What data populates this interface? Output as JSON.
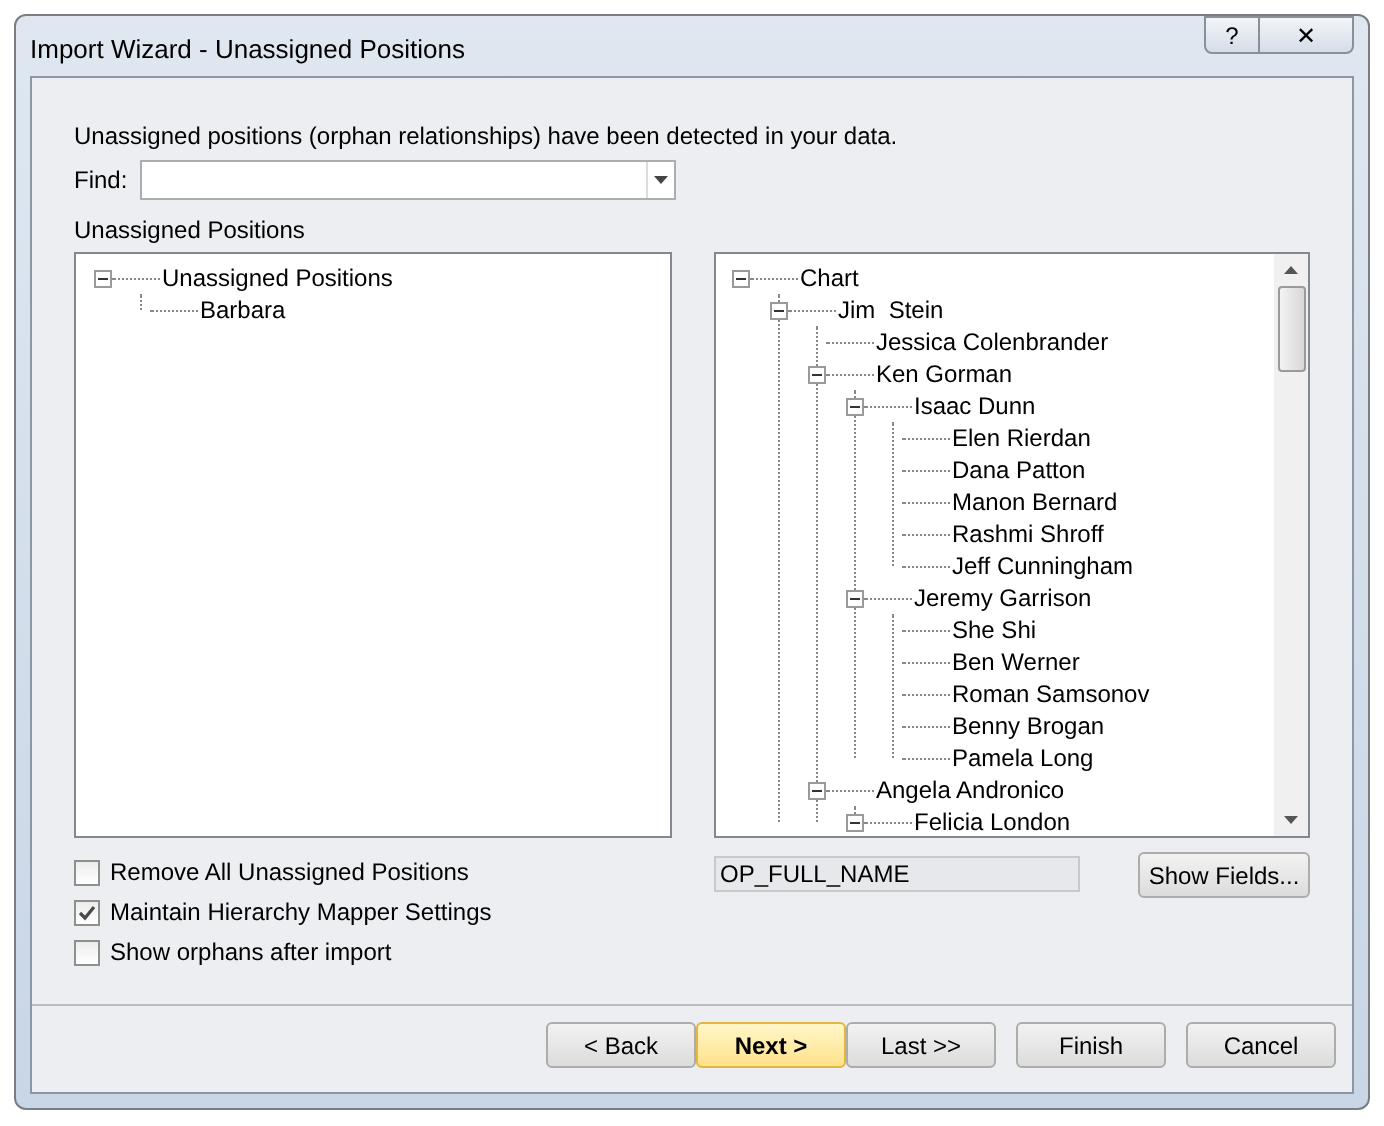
{
  "window": {
    "title": "Import Wizard - Unassigned Positions",
    "controls": [
      "?",
      "✕"
    ]
  },
  "intro": "Unassigned positions (orphan relationships) have been detected in your data.",
  "find": {
    "label": "Find:"
  },
  "unassigned_label": "Unassigned Positions",
  "unassigned_tree": [
    {
      "label": "Unassigned Positions",
      "expanded": true,
      "children": [
        {
          "label": "Barbara"
        }
      ]
    }
  ],
  "chart_tree": [
    {
      "label": "Chart",
      "expanded": true,
      "children": [
        {
          "label": "Jim  Stein",
          "expanded": true,
          "children": [
            {
              "label": "Jessica Colenbrander"
            },
            {
              "label": "Ken Gorman",
              "expanded": true,
              "children": [
                {
                  "label": "Isaac Dunn",
                  "expanded": true,
                  "children": [
                    {
                      "label": "Elen Rierdan"
                    },
                    {
                      "label": "Dana Patton"
                    },
                    {
                      "label": "Manon Bernard"
                    },
                    {
                      "label": "Rashmi Shroff"
                    },
                    {
                      "label": "Jeff Cunningham"
                    }
                  ]
                },
                {
                  "label": "Jeremy Garrison",
                  "expanded": true,
                  "children": [
                    {
                      "label": "She Shi"
                    },
                    {
                      "label": "Ben Werner"
                    },
                    {
                      "label": "Roman Samsonov"
                    },
                    {
                      "label": "Benny Brogan"
                    },
                    {
                      "label": "Pamela Long"
                    }
                  ]
                }
              ]
            },
            {
              "label": "Angela Andronico",
              "expanded": true,
              "children": [
                {
                  "label": "Felicia London",
                  "expanded": true
                }
              ]
            }
          ]
        }
      ]
    }
  ],
  "options": [
    {
      "label": "Remove All Unassigned Positions",
      "checked": false
    },
    {
      "label": "Maintain Hierarchy Mapper Settings",
      "checked": true
    },
    {
      "label": "Show orphans after import",
      "checked": false
    }
  ],
  "field_name": "OP_FULL_NAME",
  "show_fields_button": "Show Fields...",
  "buttons": [
    {
      "label": "< Back",
      "primary": false
    },
    {
      "label": "Next >",
      "primary": true
    },
    {
      "label": "Last >>",
      "primary": false
    },
    {
      "label": "Finish",
      "primary": false
    },
    {
      "label": "Cancel",
      "primary": false
    }
  ]
}
